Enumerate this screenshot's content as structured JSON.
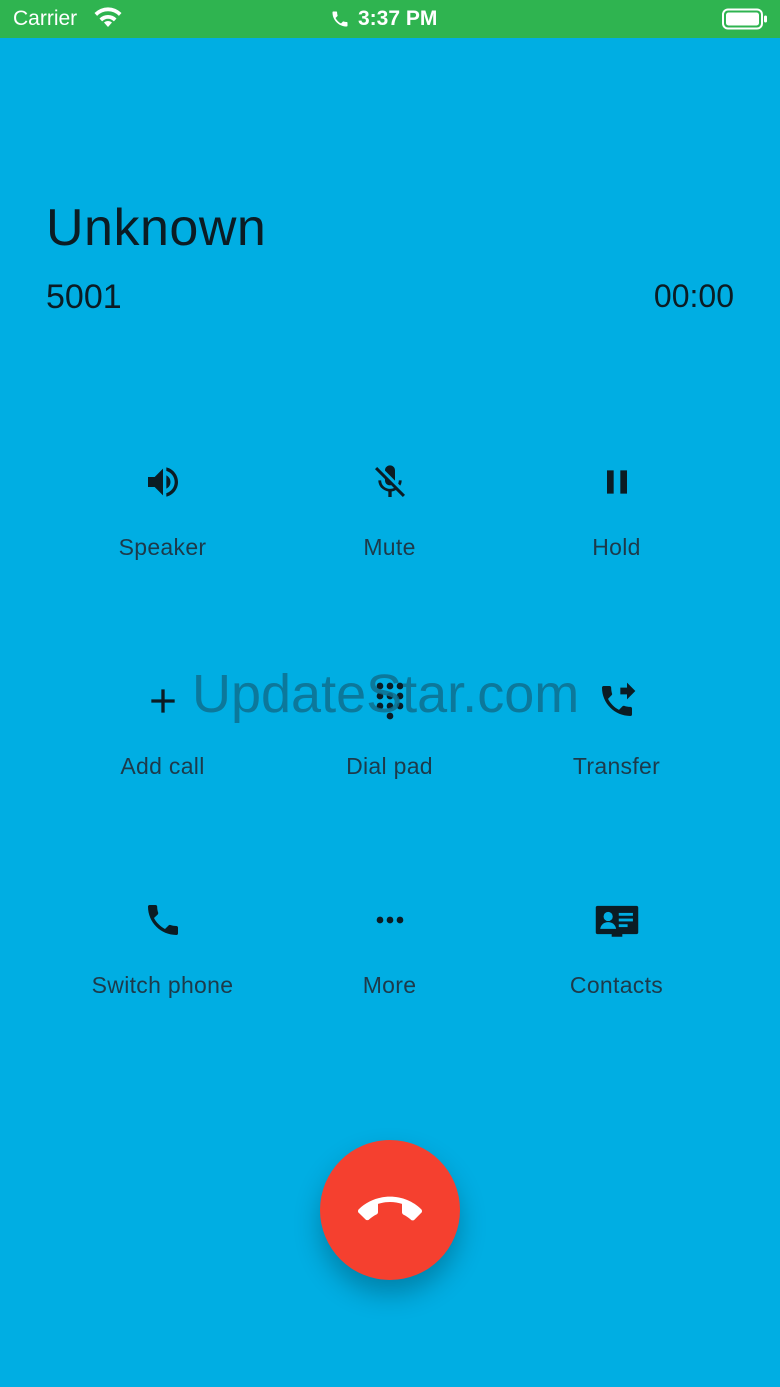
{
  "status_bar": {
    "carrier": "Carrier",
    "time": "3:37 PM",
    "wifi_icon": "wifi-icon",
    "call_icon": "phone-icon",
    "battery_icon": "battery-icon"
  },
  "call": {
    "caller_name": "Unknown",
    "caller_number": "5001",
    "duration": "00:00"
  },
  "controls": {
    "speaker": {
      "label": "Speaker",
      "icon": "speaker-icon"
    },
    "mute": {
      "label": "Mute",
      "icon": "mic-off-icon"
    },
    "hold": {
      "label": "Hold",
      "icon": "pause-icon"
    },
    "add_call": {
      "label": "Add call",
      "icon": "plus-icon"
    },
    "dial_pad": {
      "label": "Dial pad",
      "icon": "dialpad-icon"
    },
    "transfer": {
      "label": "Transfer",
      "icon": "phone-forward-icon"
    },
    "switch_phone": {
      "label": "Switch phone",
      "icon": "phone-icon"
    },
    "more": {
      "label": "More",
      "icon": "more-horizontal-icon"
    },
    "contacts": {
      "label": "Contacts",
      "icon": "contact-card-icon"
    }
  },
  "end_call": {
    "icon": "end-call-icon"
  },
  "watermark": {
    "text": "UpdateStar.com"
  },
  "colors": {
    "background": "#00AEE3",
    "status_bar": "#2FB450",
    "end_call": "#F5402F",
    "text_dark": "#0b1c24"
  }
}
